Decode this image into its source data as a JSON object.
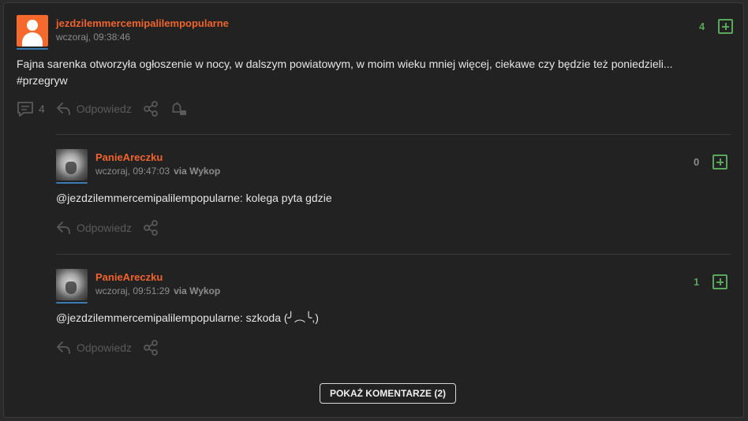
{
  "post": {
    "username": "jezdzilemmercemipalilempopularne",
    "timestamp": "wczoraj, 09:38:46",
    "score": "4",
    "text": "Fajna sarenka otworzyła ogłoszenie w nocy, w dalszym powiatowym, w moim wieku mniej więcej, ciekawe czy będzie też poniedzieli...",
    "tag": "#przegryw",
    "comment_count": "4",
    "reply_label": "Odpowiedz"
  },
  "comments": [
    {
      "username": "PanieAreczku",
      "timestamp": "wczoraj, 09:47:03",
      "via": "via Wykop",
      "score": "0",
      "mention": "@jezdzilemmercemipalilempopularne:",
      "text": " kolega pyta gdzie",
      "reply_label": "Odpowiedz"
    },
    {
      "username": "PanieAreczku",
      "timestamp": "wczoraj, 09:51:29",
      "via": "via Wykop",
      "score": "1",
      "mention": "@jezdzilemmercemipalilempopularne:",
      "text": " szkoda (╯︵╰,)",
      "reply_label": "Odpowiedz"
    }
  ],
  "show_comments_label": "POKAŻ KOMENTARZE (2)",
  "colors": {
    "accent": "#f0632b",
    "score_positive": "#5aa65a",
    "score_zero": "#8c8c8c",
    "background": "#222223"
  }
}
